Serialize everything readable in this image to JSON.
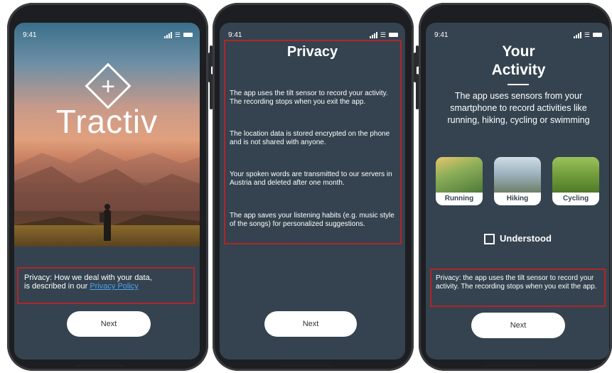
{
  "phones": {
    "one": {
      "time": "9:41",
      "brand": "Tractiv",
      "privacy_line1": "Privacy: How we deal with your data,",
      "privacy_line2": "is described in our ",
      "privacy_link": "Privacy Policy",
      "next_label": "Next"
    },
    "two": {
      "time": "9:41",
      "title": "Privacy",
      "paragraphs": [
        "The app uses the tilt sensor to record your activity. The recording stops when you exit the app.",
        "The location data is stored encrypted on the phone and is not shared with anyone.",
        "Your spoken words are transmitted to our servers in Austria and deleted after one month.",
        "The app saves your listening habits (e.g. music style of the songs) for personalized suggestions."
      ],
      "next_label": "Next"
    },
    "three": {
      "time": "9:41",
      "title_line1": "Your",
      "title_line2": "Activity",
      "description": "The app uses sensors from your smartphone to record activities like running, hiking, cycling or swimming",
      "activities": [
        "Running",
        "Hiking",
        "Cycling"
      ],
      "checkbox_label": "Understood",
      "privacy_note": "Privacy: the app uses the tilt sensor to record your activity. The recording stops when you exit the app.",
      "next_label": "Next"
    }
  },
  "colors": {
    "screen_bg": "#34434f",
    "highlight_border": "#b2252b",
    "link": "#4aa3f0"
  }
}
